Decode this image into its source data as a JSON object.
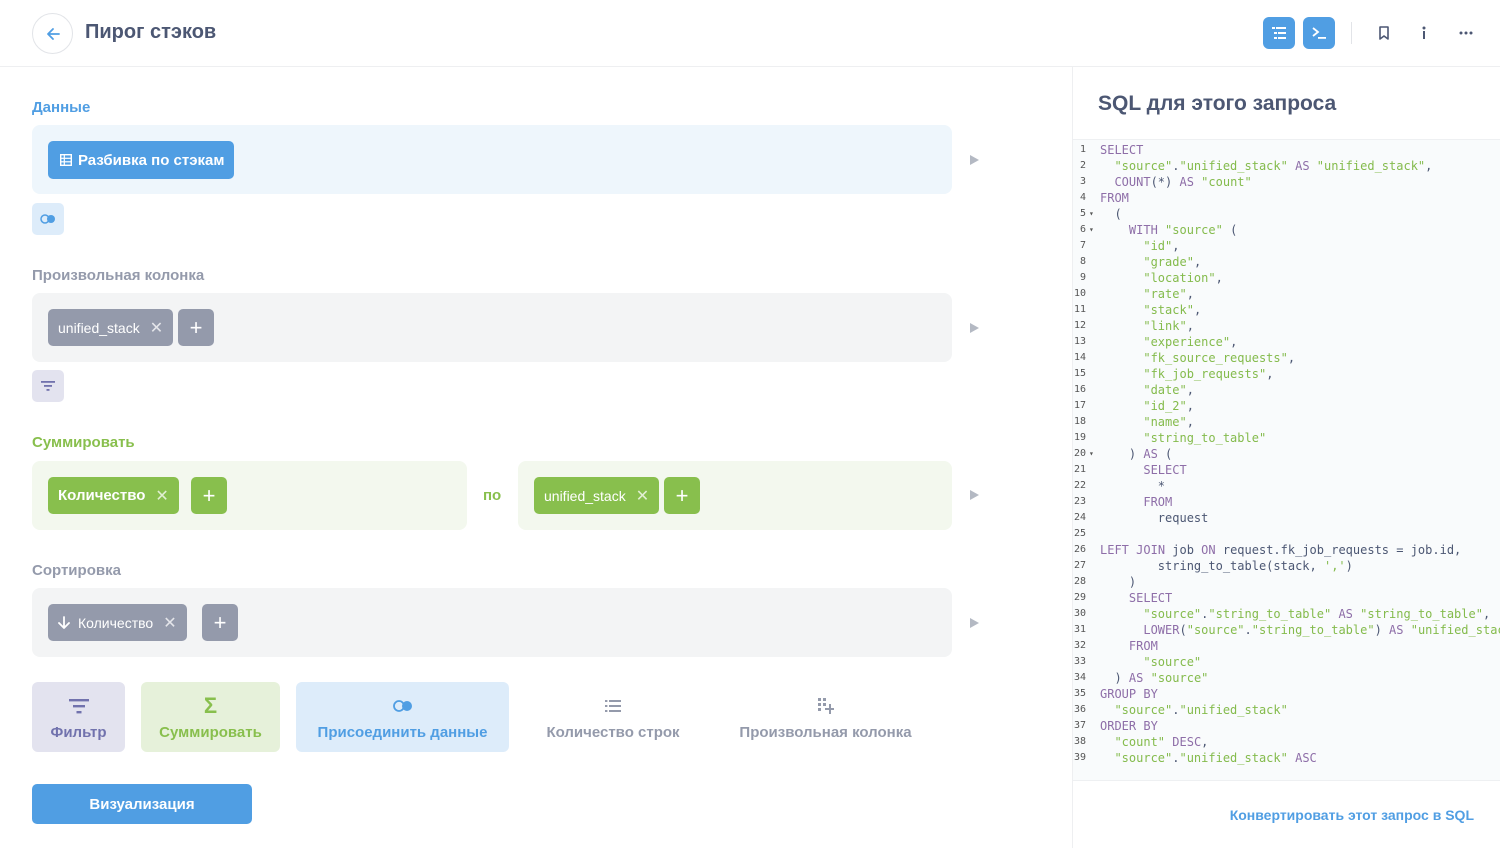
{
  "header": {
    "title": "Пирог стэков"
  },
  "sections": {
    "data_label": "Данные",
    "data_table": "Разбивка по стэкам",
    "custom_column_label": "Произвольная колонка",
    "custom_column_value": "unified_stack",
    "summarize_label": "Суммировать",
    "summarize_metric": "Количество",
    "by_label": "по",
    "group_by_value": "unified_stack",
    "sort_label": "Сортировка",
    "sort_value": "Количество"
  },
  "actions": {
    "filter": "Фильтр",
    "summarize": "Суммировать",
    "join": "Присоединить данные",
    "row_count": "Количество строк",
    "custom_column": "Произвольная колонка"
  },
  "visualize_button": "Визуализация",
  "sidebar": {
    "title": "SQL для этого запроса",
    "convert_link": "Конвертировать этот запрос в SQL",
    "code_lines": [
      "SELECT",
      "  \"source\".\"unified_stack\" AS \"unified_stack\",",
      "  COUNT(*) AS \"count\"",
      "FROM",
      "  (",
      "    WITH \"source\" (",
      "      \"id\",",
      "      \"grade\",",
      "      \"location\",",
      "      \"rate\",",
      "      \"stack\",",
      "      \"link\",",
      "      \"experience\",",
      "      \"fk_source_requests\",",
      "      \"fk_job_requests\",",
      "      \"date\",",
      "      \"id_2\",",
      "      \"name\",",
      "      \"string_to_table\"",
      "    ) AS (",
      "      SELECT",
      "        *",
      "      FROM",
      "        request",
      "",
      "LEFT JOIN job ON request.fk_job_requests = job.id,",
      "        string_to_table(stack, ',')",
      "    )",
      "    SELECT",
      "      \"source\".\"string_to_table\" AS \"string_to_table\",",
      "      LOWER(\"source\".\"string_to_table\") AS \"unified_stack\"",
      "    FROM",
      "      \"source\"",
      "  ) AS \"source\"",
      "GROUP BY",
      "  \"source\".\"unified_stack\"",
      "ORDER BY",
      "  \"count\" DESC,",
      "  \"source\".\"unified_stack\" ASC"
    ],
    "folded_lines": [
      5,
      6,
      20
    ]
  },
  "colors": {
    "brand": "#509ee3",
    "summarize": "#88bf4d",
    "filter": "#7172ad",
    "gray_pill": "#949aab"
  }
}
